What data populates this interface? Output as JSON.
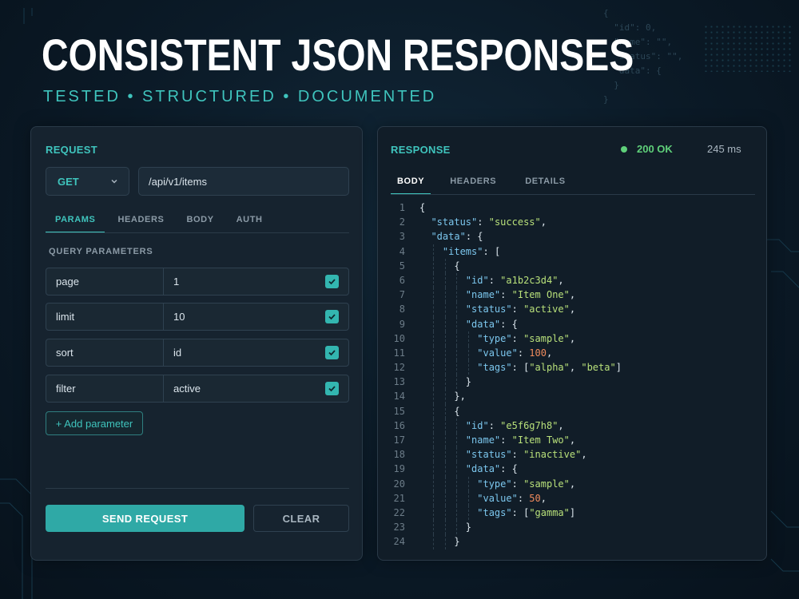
{
  "hero": {
    "title": "CONSISTENT JSON RESPONSES",
    "subtitle": "TESTED • STRUCTURED • DOCUMENTED"
  },
  "background_code": "{\n  \"id\": 0,\n  \"name\": \"\",\n  \"status\": \"\",\n  \"data\": {\n  }\n}",
  "request": {
    "title": "REQUEST",
    "method": "GET",
    "url": "/api/v1/items",
    "tabs": [
      {
        "label": "PARAMS",
        "active": true
      },
      {
        "label": "HEADERS",
        "active": false
      },
      {
        "label": "BODY",
        "active": false
      },
      {
        "label": "AUTH",
        "active": false
      }
    ],
    "section_label": "QUERY PARAMETERS",
    "params": [
      {
        "key": "page",
        "value": "1",
        "enabled": true
      },
      {
        "key": "limit",
        "value": "10",
        "enabled": true
      },
      {
        "key": "sort",
        "value": "id",
        "enabled": true
      },
      {
        "key": "filter",
        "value": "active",
        "enabled": true
      }
    ],
    "add_param_label": "+ Add parameter",
    "send_label": "SEND REQUEST",
    "clear_label": "CLEAR"
  },
  "response": {
    "title": "RESPONSE",
    "status": "200 OK",
    "status_color": "#5fd07a",
    "timing": "245 ms",
    "tabs": [
      {
        "label": "BODY",
        "active": true
      },
      {
        "label": "HEADERS",
        "active": false
      },
      {
        "label": "DETAILS",
        "active": false
      }
    ],
    "code_lines": [
      "{",
      "  \"status\": \"success\",",
      "  \"data\": {",
      "    \"items\": [",
      "      {",
      "        \"id\": \"a1b2c3d4\",",
      "        \"name\": \"Item One\",",
      "        \"status\": \"active\",",
      "        \"data\": {",
      "          \"type\": \"sample\",",
      "          \"value\": 100,",
      "          \"tags\": [\"alpha\", \"beta\"]",
      "        }",
      "      },",
      "      {",
      "        \"id\": \"e5f6g7h8\",",
      "        \"name\": \"Item Two\",",
      "        \"status\": \"inactive\",",
      "        \"data\": {",
      "          \"type\": \"sample\",",
      "          \"value\": 50,",
      "          \"tags\": [\"gamma\"]",
      "        }",
      "      }"
    ]
  },
  "colors": {
    "accent": "#3fc4bd",
    "key": "#7cc7ee",
    "string": "#b8e07a",
    "number": "#ef8a5c"
  }
}
